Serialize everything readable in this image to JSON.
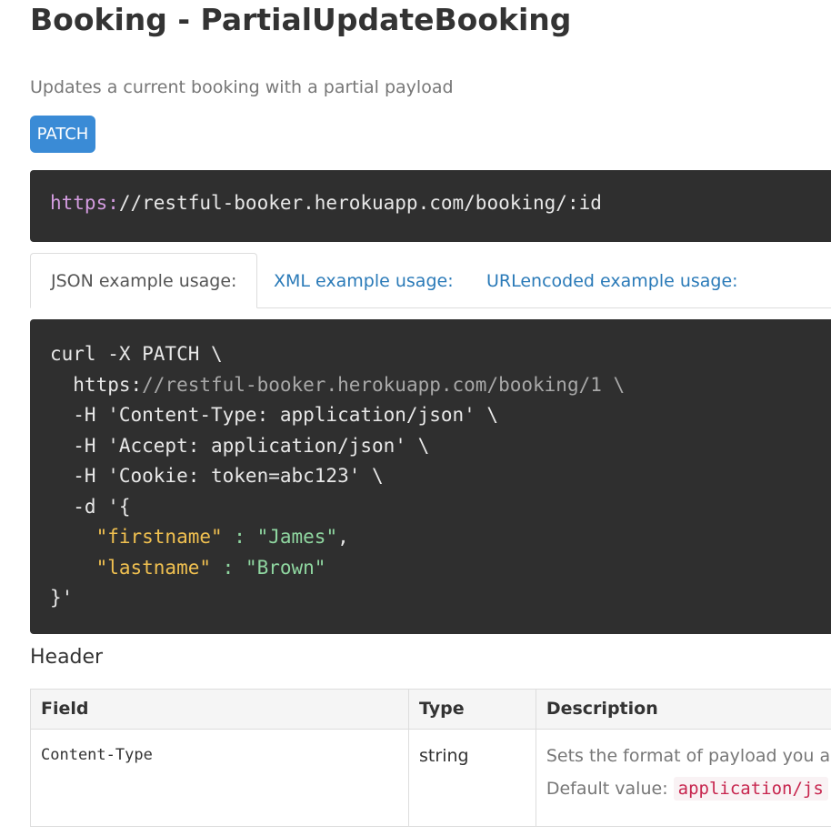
{
  "page": {
    "title": "Booking - PartialUpdateBooking",
    "subtitle": "Updates a current booking with a partial payload",
    "method": "PATCH"
  },
  "endpoint": {
    "scheme": "https:",
    "rest": "//restful-booker.herokuapp.com/booking/:id"
  },
  "tabs": [
    {
      "label": "JSON example usage:",
      "active": true
    },
    {
      "label": "XML example usage:",
      "active": false
    },
    {
      "label": "URLencoded example usage:",
      "active": false
    }
  ],
  "code": {
    "line1": "curl -X PATCH \\",
    "line2_scheme": "  https:",
    "line2_rest": "//restful-booker.herokuapp.com/booking/1 \\",
    "line3": "  -H 'Content-Type: application/json' \\",
    "line4": "  -H 'Accept: application/json' \\",
    "line5": "  -H 'Cookie: token=abc123' \\",
    "line6": "  -d '{",
    "line7_key": "    \"firstname\"",
    "line7_sep": " : ",
    "line7_val": "\"James\"",
    "line7_end": ",",
    "line8_key": "    \"lastname\"",
    "line8_sep": " : ",
    "line8_val": "\"Brown\"",
    "line9": "}'"
  },
  "header_section": {
    "title": "Header",
    "columns": [
      "Field",
      "Type",
      "Description"
    ],
    "rows": [
      {
        "field": "Content-Type",
        "type": "string",
        "description": "Sets the format of payload you ar",
        "default_label": "Default value: ",
        "default_value": "application/js"
      }
    ]
  }
}
